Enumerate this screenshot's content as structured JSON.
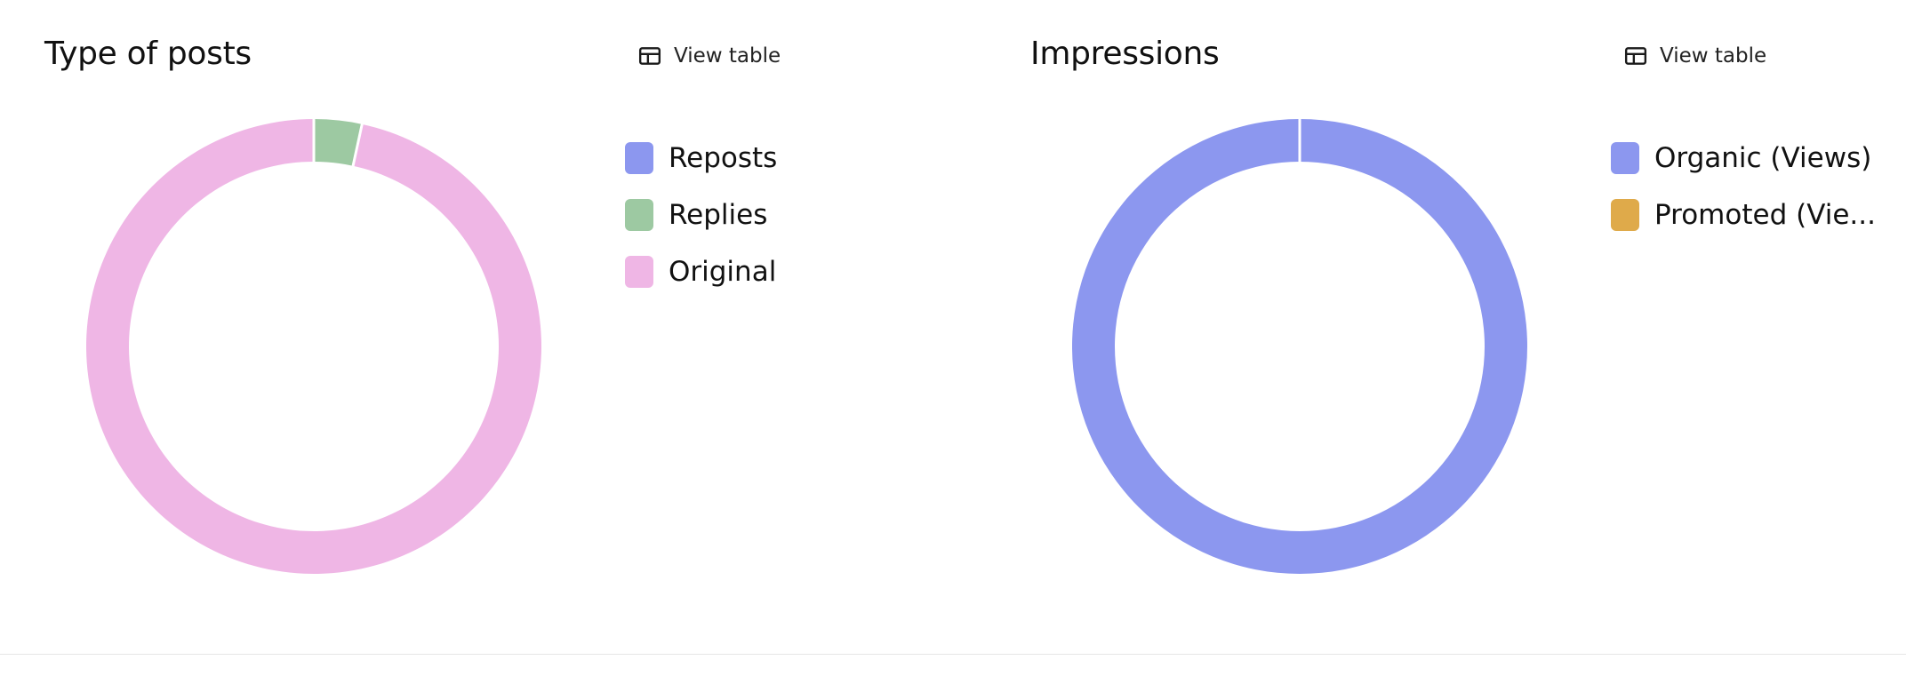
{
  "chart_data": [
    {
      "type": "pie",
      "title": "Type of posts",
      "donut": true,
      "legend_position": "right",
      "categories": [
        "Reposts",
        "Replies",
        "Original"
      ],
      "values": [
        0,
        3.4,
        96.6
      ],
      "colors": [
        "#8c97ef",
        "#9dc9a2",
        "#efb6e5"
      ],
      "view_table_label": "View table"
    },
    {
      "type": "pie",
      "title": "Impressions",
      "donut": true,
      "legend_position": "right",
      "categories": [
        "Organic (Views)",
        "Promoted (Views)"
      ],
      "legend_display": [
        "Organic (Views)",
        "Promoted (Vie..."
      ],
      "values": [
        100,
        0
      ],
      "colors": [
        "#8c97ef",
        "#dfaa4a"
      ],
      "view_table_label": "View table"
    }
  ],
  "icons": {
    "view_table": "table-icon"
  }
}
